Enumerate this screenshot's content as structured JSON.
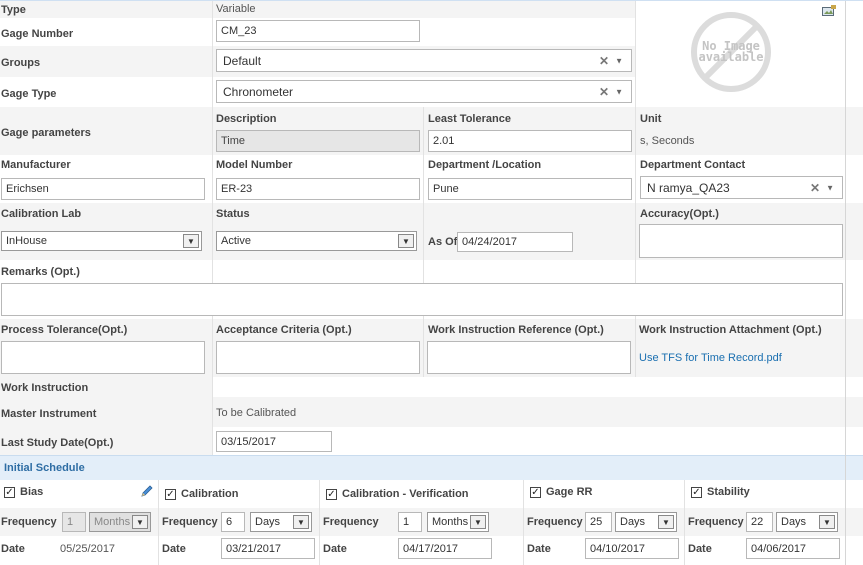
{
  "form": {
    "type_label": "Type",
    "type_value": "Variable",
    "gage_number_label": "Gage Number",
    "gage_number_value": "CM_23",
    "groups_label": "Groups",
    "groups_value": "Default",
    "gage_type_label": "Gage Type",
    "gage_type_value": "Chronometer",
    "gage_params_label": "Gage parameters",
    "description_label": "Description",
    "description_value": "Time",
    "least_tolerance_label": "Least Tolerance",
    "least_tolerance_value": "2.01",
    "unit_label": "Unit",
    "unit_value": "s, Seconds",
    "manufacturer_label": "Manufacturer",
    "manufacturer_value": "Erichsen",
    "model_number_label": "Model Number",
    "model_number_value": "ER-23",
    "department_label": "Department /Location",
    "department_value": "Pune",
    "department_contact_label": "Department Contact",
    "department_contact_value": "N ramya_QA23",
    "calibration_lab_label": "Calibration Lab",
    "calibration_lab_value": "InHouse",
    "status_label": "Status",
    "status_value": "Active",
    "as_of_label": "As Of",
    "as_of_value": "04/24/2017",
    "accuracy_label": "Accuracy(Opt.)",
    "remarks_label": "Remarks (Opt.)",
    "process_tolerance_label": "Process Tolerance(Opt.)",
    "acceptance_criteria_label": "Acceptance Criteria (Opt.)",
    "work_instruction_ref_label": "Work Instruction Reference (Opt.)",
    "work_instruction_attach_label": "Work Instruction Attachment (Opt.)",
    "work_instruction_attach_link": "Use TFS for Time Record.pdf",
    "work_instruction_label": "Work Instruction",
    "master_instrument_label": "Master Instrument",
    "master_instrument_value": "To be Calibrated",
    "last_study_label": "Last Study Date(Opt.)",
    "last_study_value": "03/15/2017",
    "no_image_line1": "No Image",
    "no_image_line2": "available"
  },
  "schedule": {
    "title": "Initial Schedule",
    "frequency_label": "Frequency",
    "date_label": "Date",
    "columns": [
      {
        "name": "Bias",
        "checked": true,
        "freq": "1",
        "unit": "Months",
        "date": "05/25/2017",
        "disabled": true
      },
      {
        "name": "Calibration",
        "checked": true,
        "freq": "6",
        "unit": "Days",
        "date": "03/21/2017",
        "disabled": false
      },
      {
        "name": "Calibration - Verification",
        "checked": true,
        "freq": "1",
        "unit": "Months",
        "date": "04/17/2017",
        "disabled": false
      },
      {
        "name": "Gage RR",
        "checked": true,
        "freq": "25",
        "unit": "Days",
        "date": "04/10/2017",
        "disabled": false
      },
      {
        "name": "Stability",
        "checked": true,
        "freq": "22",
        "unit": "Days",
        "date": "04/06/2017",
        "disabled": false
      }
    ]
  },
  "icons": {
    "image_upload": "image-upload-icon",
    "edit": "pencil-icon",
    "clear": "clear-x-icon",
    "caret": "caret-down-icon"
  },
  "colors": {
    "row_alt": "#f4f4f4",
    "schedule_header_bg": "#e3eef9",
    "schedule_title": "#2e6da4",
    "link": "#1a6fb0"
  }
}
